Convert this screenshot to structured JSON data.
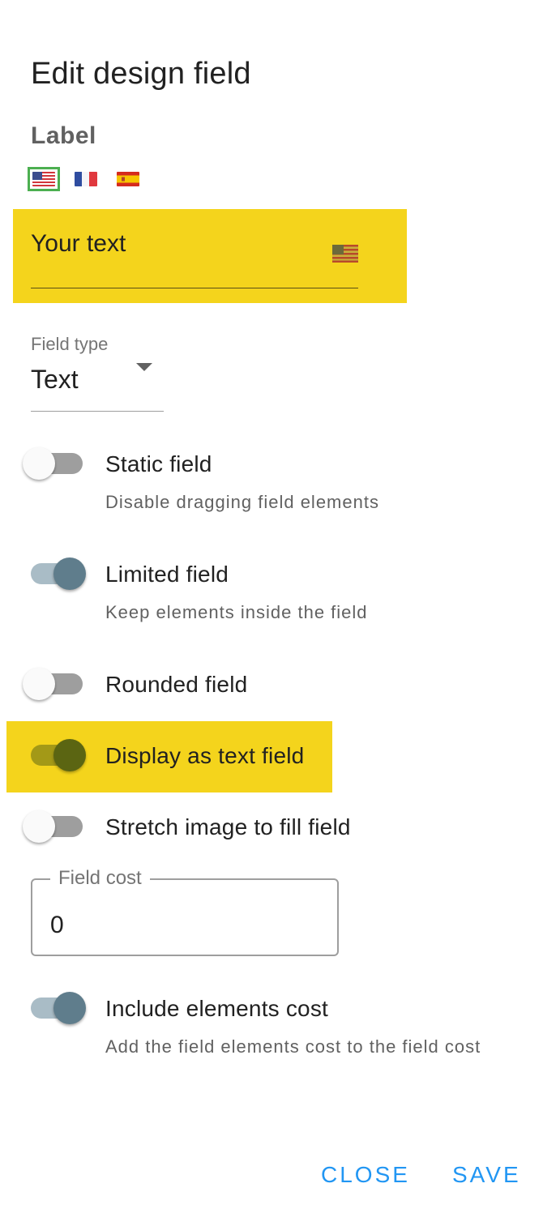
{
  "dialog": {
    "title": "Edit design field",
    "label_heading": "Label",
    "languages": [
      {
        "code": "en",
        "icon": "us-flag-icon",
        "selected": true
      },
      {
        "code": "fr",
        "icon": "france-flag-icon",
        "selected": false
      },
      {
        "code": "es",
        "icon": "spain-flag-icon",
        "selected": false
      }
    ],
    "label_input": {
      "value": "Your text",
      "flag_icon": "us-flag-icon"
    },
    "field_type": {
      "caption": "Field type",
      "value": "Text"
    },
    "options": [
      {
        "label": "Static field",
        "description": "Disable dragging field elements",
        "checked": false
      },
      {
        "label": "Limited field",
        "description": "Keep elements inside the field",
        "checked": true
      },
      {
        "label": "Rounded field",
        "checked": false
      },
      {
        "label": "Display as text field",
        "checked": true
      },
      {
        "label": "Stretch image to fill field",
        "checked": false
      }
    ],
    "field_cost": {
      "legend": "Field cost",
      "value": "0"
    },
    "include_cost": {
      "label": "Include elements cost",
      "description": "Add the field elements cost to the field cost",
      "checked": true
    },
    "actions": {
      "close": "CLOSE",
      "save": "SAVE"
    }
  },
  "colors": {
    "highlight": "#f4d41c",
    "accent": "#2196f3",
    "selected_flag_border": "#4caf50",
    "switch_on": "#5f7d8c"
  }
}
